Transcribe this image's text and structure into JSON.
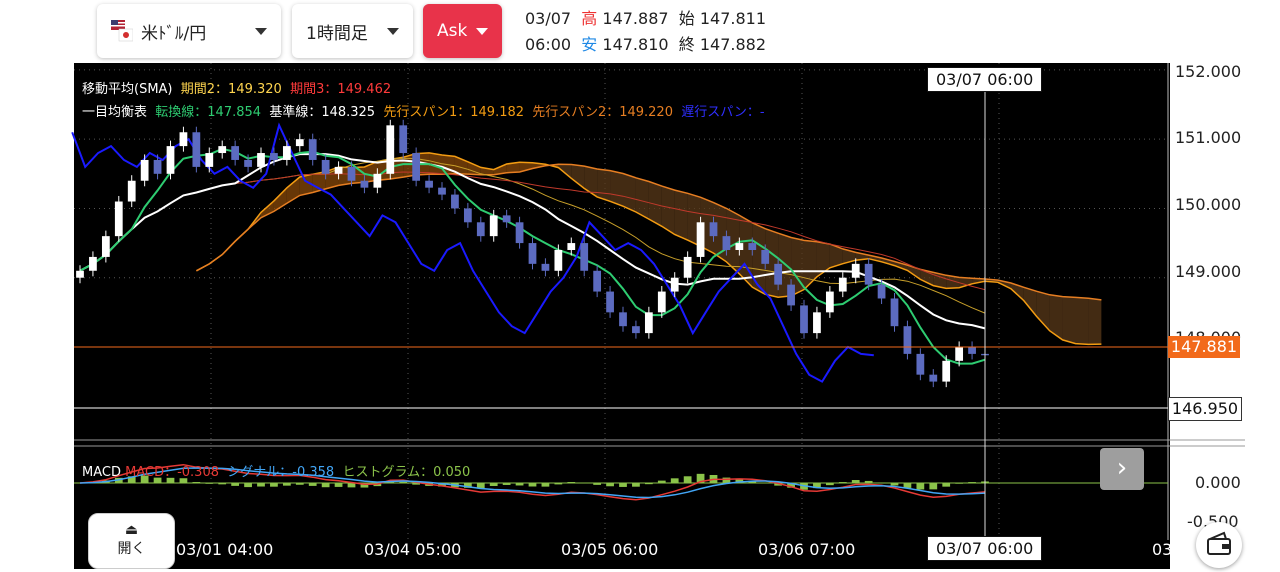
{
  "toolbar": {
    "pair_label": "米ﾄﾞﾙ/円",
    "timeframe_label": "1時間足",
    "side_label": "Ask"
  },
  "ohlc": {
    "date": "03/07",
    "time": "06:00",
    "high_label": "高",
    "high": "147.887",
    "low_label": "安",
    "low": "147.810",
    "open_label": "始",
    "open": "147.811",
    "close_label": "終",
    "close": "147.882"
  },
  "legend": {
    "sma_title": "移動平均(SMA)",
    "sma_p2": "期間2：149.320",
    "sma_p3": "期間3：149.462",
    "ichimoku_title": "一目均衡表",
    "tenkan": "転換線：147.854",
    "kijun": "基準線：148.325",
    "senkou1": "先行スパン1：149.182",
    "senkou2": "先行スパン2：149.220",
    "chikou": "遅行スパン：-",
    "macd_title": "MACD",
    "macd": "MACD：-0.308",
    "signal": "シグナル：-0.358",
    "hist": "ヒストグラム：0.050"
  },
  "y_axis": [
    "152.000",
    "151.000",
    "150.000",
    "149.000",
    "148.000",
    "146.950"
  ],
  "macd_axis": [
    "0.000",
    "-0.500"
  ],
  "x_axis": [
    "03/01 04:00",
    "03/04 05:00",
    "03/05 06:00",
    "03/06 07:00",
    "03/07 06:00",
    "03"
  ],
  "crosshair": {
    "top_label": "03/07 06:00",
    "bottom_label": "03/07 06:00",
    "level_label": "146.950"
  },
  "current_price": "147.881",
  "open_panel_label": "開く",
  "open_panel_icon": "eject-icon",
  "next_icon": "chevron-right-icon",
  "wallet_icon": "wallet-icon",
  "colors": {
    "up": "#ffffff",
    "down": "#5c6bc0",
    "tenkan": "#2ecc71",
    "kijun": "#ffffff",
    "senkou1": "#f39c12",
    "senkou2": "#e67e22",
    "chikou": "#1a1aff",
    "price": "#f26a1b",
    "macd": "#e53935",
    "signal": "#42a5f5",
    "hist": "#8bc34a"
  },
  "chart_data": {
    "type": "candlestick",
    "y_range": [
      146.7,
      152.1
    ],
    "closes": [
      149.1,
      149.3,
      149.6,
      150.1,
      150.4,
      150.7,
      150.5,
      150.9,
      151.1,
      150.6,
      150.8,
      150.9,
      150.7,
      150.6,
      150.8,
      150.7,
      150.9,
      151.0,
      150.7,
      150.5,
      150.6,
      150.4,
      150.3,
      150.5,
      151.2,
      150.8,
      150.4,
      150.3,
      150.2,
      150.0,
      149.8,
      149.6,
      149.9,
      149.8,
      149.5,
      149.2,
      149.1,
      149.4,
      149.5,
      149.1,
      148.8,
      148.5,
      148.3,
      148.2,
      148.5,
      148.8,
      149.0,
      149.3,
      149.8,
      149.6,
      149.4,
      149.5,
      149.4,
      149.2,
      148.9,
      148.6,
      148.2,
      148.5,
      148.8,
      149.0,
      149.2,
      148.9,
      148.7,
      148.3,
      147.9,
      147.6,
      147.5,
      147.8,
      148.0,
      147.9,
      147.88
    ]
  }
}
